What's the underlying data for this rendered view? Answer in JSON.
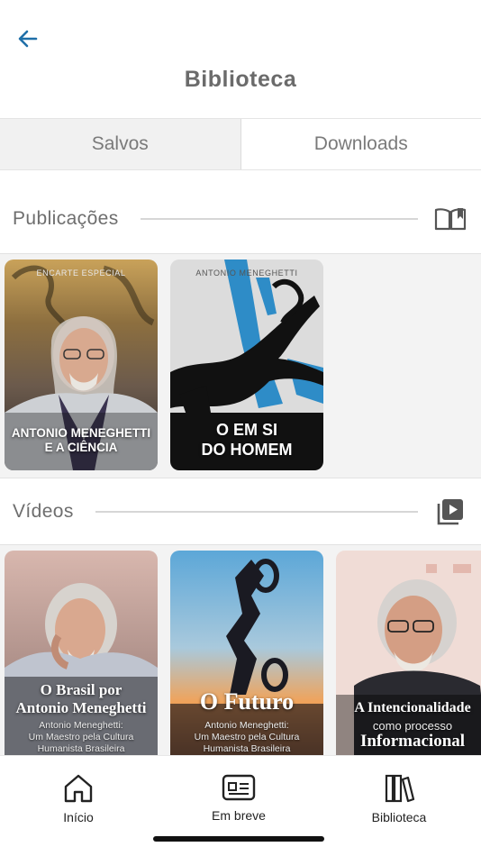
{
  "header": {
    "back_icon": "arrow-left-icon",
    "title": "Biblioteca",
    "accent": "#1f6fa8"
  },
  "tabs": [
    {
      "label": "Salvos",
      "active": true
    },
    {
      "label": "Downloads",
      "active": false
    }
  ],
  "publicacoes": {
    "title": "Publicações",
    "icon": "open-book-icon",
    "items": [
      {
        "kicker": "ENCARTE ESPECIAL",
        "line1": "ANTONIO MENEGHETTI",
        "line2": "E A CIÊNCIA"
      },
      {
        "kicker": "ANTONIO MENEGHETTI",
        "line1": "O EM SI",
        "line2": "DO HOMEM"
      }
    ]
  },
  "videos": {
    "title": "Vídeos",
    "icon": "video-library-icon",
    "items": [
      {
        "line1": "O Brasil por",
        "line2": "Antonio Meneghetti",
        "sub1": "Antonio Meneghetti:",
        "sub2": "Um Maestro pela Cultura",
        "sub3": "Humanista Brasileira"
      },
      {
        "line1": "O Futuro",
        "sub1": "Antonio Meneghetti:",
        "sub2": "Um Maestro pela Cultura",
        "sub3": "Humanista Brasileira"
      },
      {
        "line1": "A Intencionalidade",
        "line2": "como processo",
        "line3": "Informacional"
      }
    ]
  },
  "nav": [
    {
      "label": "Início",
      "icon": "home-icon"
    },
    {
      "label": "Em breve",
      "icon": "newspaper-icon"
    },
    {
      "label": "Biblioteca",
      "icon": "books-icon"
    }
  ]
}
